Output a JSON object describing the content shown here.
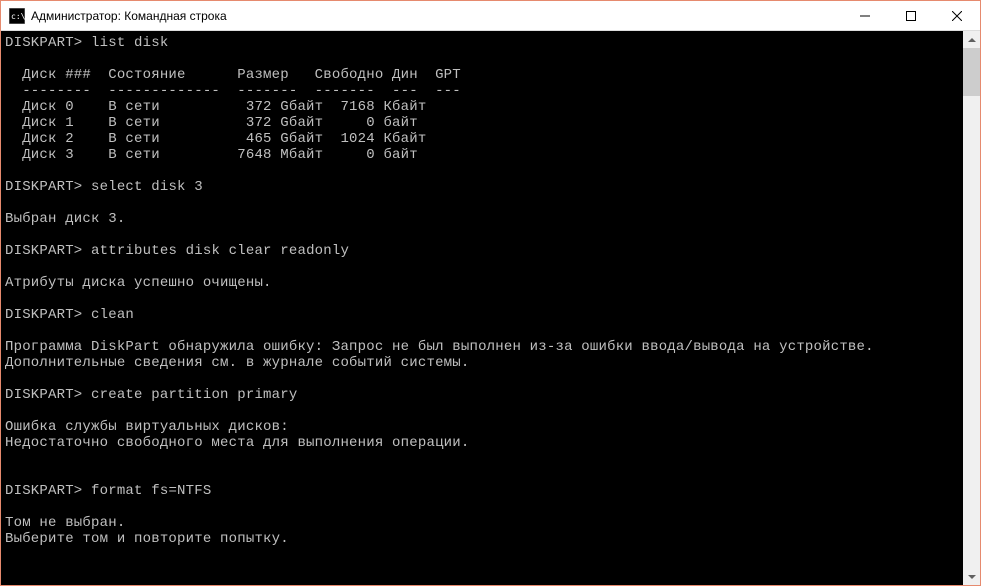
{
  "titlebar": {
    "text": "Администратор: Командная строка"
  },
  "terminal": {
    "prompt": "DISKPART>",
    "cmd_list_disk": "list disk",
    "disk_table": {
      "header": "  Диск ###  Состояние      Размер   Свободно Дин  GPT",
      "divider": "  --------  -------------  -------  -------  ---  ---",
      "rows": [
        "  Диск 0    В сети          372 Gбайт  7168 Кбайт",
        "  Диск 1    В сети          372 Gбайт     0 байт",
        "  Диск 2    В сети          465 Gбайт  1024 Кбайт",
        "  Диск 3    В сети         7648 Mбайт     0 байт"
      ]
    },
    "cmd_select_disk": "select disk 3",
    "resp_select_disk": "Выбран диск 3.",
    "cmd_attributes": "attributes disk clear readonly",
    "resp_attributes": "Атрибуты диска успешно очищены.",
    "cmd_clean": "clean",
    "resp_clean_1": "Программа DiskPart обнаружила ошибку: Запрос не был выполнен из-за ошибки ввода/вывода на устройстве.",
    "resp_clean_2": "Дополнительные сведения см. в журнале событий системы.",
    "cmd_create_part": "create partition primary",
    "resp_create_1": "Ошибка службы виртуальных дисков:",
    "resp_create_2": "Недостаточно свободного места для выполнения операции.",
    "cmd_format": "format fs=NTFS",
    "resp_format_1": "Том не выбран.",
    "resp_format_2": "Выберите том и повторите попытку."
  }
}
